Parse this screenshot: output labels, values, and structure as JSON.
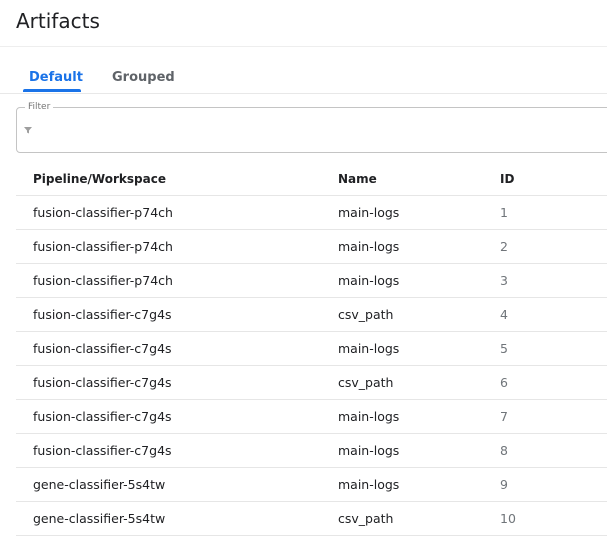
{
  "page": {
    "title": "Artifacts"
  },
  "tabs": [
    {
      "label": "Default",
      "active": true
    },
    {
      "label": "Grouped",
      "active": false
    }
  ],
  "filter": {
    "label": "Filter",
    "value": "",
    "icon": "filter-icon"
  },
  "table": {
    "columns": [
      "Pipeline/Workspace",
      "Name",
      "ID"
    ],
    "rows": [
      {
        "pipeline": "fusion-classifier-p74ch",
        "name": "main-logs",
        "id": "1"
      },
      {
        "pipeline": "fusion-classifier-p74ch",
        "name": "main-logs",
        "id": "2"
      },
      {
        "pipeline": "fusion-classifier-p74ch",
        "name": "main-logs",
        "id": "3"
      },
      {
        "pipeline": "fusion-classifier-c7g4s",
        "name": "csv_path",
        "id": "4"
      },
      {
        "pipeline": "fusion-classifier-c7g4s",
        "name": "main-logs",
        "id": "5"
      },
      {
        "pipeline": "fusion-classifier-c7g4s",
        "name": "csv_path",
        "id": "6"
      },
      {
        "pipeline": "fusion-classifier-c7g4s",
        "name": "main-logs",
        "id": "7"
      },
      {
        "pipeline": "fusion-classifier-c7g4s",
        "name": "main-logs",
        "id": "8"
      },
      {
        "pipeline": "gene-classifier-5s4tw",
        "name": "main-logs",
        "id": "9"
      },
      {
        "pipeline": "gene-classifier-5s4tw",
        "name": "csv_path",
        "id": "10"
      }
    ]
  },
  "colors": {
    "accent": "#1a73e8",
    "text": "#202124",
    "muted": "#5f6368",
    "border": "#e6e6e6"
  }
}
